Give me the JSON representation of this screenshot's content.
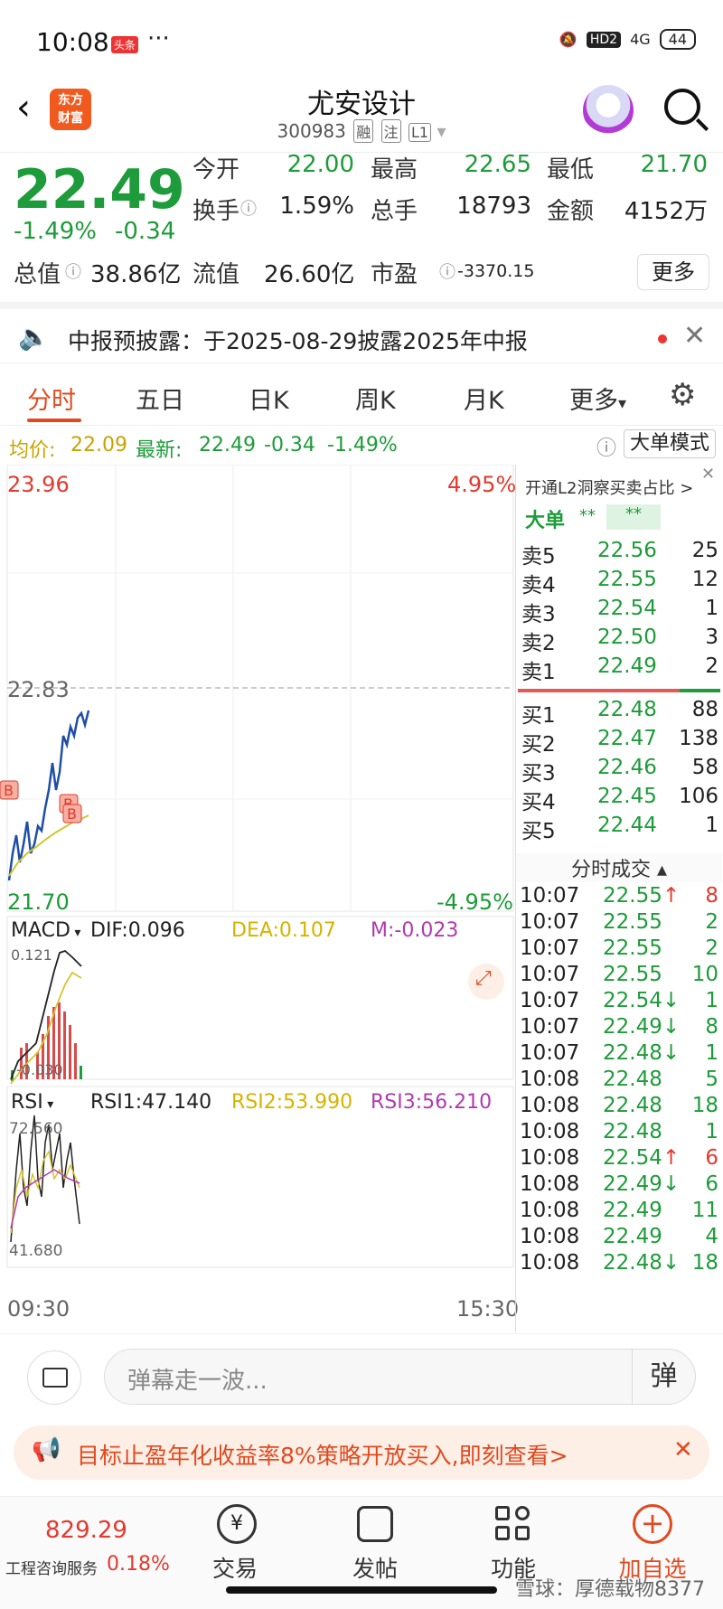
{
  "status": {
    "time": "10:08",
    "app": "头条",
    "dots": "···",
    "net": "HD2",
    "signal": "4G",
    "battery": "44"
  },
  "header": {
    "name": "尤安设计",
    "code": "300983",
    "tags": [
      "融",
      "注",
      "L1"
    ],
    "logo_line1": "东方",
    "logo_line2": "财富"
  },
  "quote": {
    "price": "22.49",
    "change_pct": "-1.49%",
    "change": "-0.34",
    "row1": [
      {
        "label": "今开",
        "value": "22.00"
      },
      {
        "label": "最高",
        "value": "22.65"
      },
      {
        "label": "最低",
        "value": "21.70"
      }
    ],
    "row2": [
      {
        "label": "换手",
        "value": "1.59%"
      },
      {
        "label": "总手",
        "value": "18793"
      },
      {
        "label": "金额",
        "value": "4152万"
      }
    ],
    "row3": [
      {
        "label": "总值",
        "value": "38.86亿"
      },
      {
        "label": "流值",
        "value": "26.60亿"
      },
      {
        "label": "市盈",
        "value": "-3370.15"
      }
    ],
    "more": "更多"
  },
  "notice": {
    "text": "中报预披露：于2025-08-29披露2025年中报"
  },
  "tabs": [
    "分时",
    "五日",
    "日K",
    "周K",
    "月K",
    "更多"
  ],
  "avg": {
    "avg_label": "均价:",
    "avg_value": "22.09",
    "last_label": "最新:",
    "last_value": "22.49",
    "chg": "-0.34",
    "pct": "-1.49%",
    "mode": "大单模式"
  },
  "chart": {
    "top": "23.96",
    "top_pct": "4.95%",
    "mid": "22.83",
    "bottom": "21.70",
    "bottom_pct": "-4.95%",
    "start": "09:30",
    "end": "15:30"
  },
  "macd": {
    "label": "MACD",
    "dif": "DIF:0.096",
    "dea": "DEA:0.107",
    "m": "M:-0.023",
    "max": "0.121",
    "min": "-0.030"
  },
  "rsi": {
    "label": "RSI",
    "rsi1": "RSI1:47.140",
    "rsi2": "RSI2:53.990",
    "rsi3": "RSI3:56.210",
    "max": "72.560",
    "min": "41.680"
  },
  "orderbook": {
    "l2": "开通L2洞察买卖占比 >",
    "bigorder": "大单",
    "stars": "**",
    "sells": [
      {
        "label": "卖5",
        "price": "22.56",
        "vol": "25"
      },
      {
        "label": "卖4",
        "price": "22.55",
        "vol": "12"
      },
      {
        "label": "卖3",
        "price": "22.54",
        "vol": "1"
      },
      {
        "label": "卖2",
        "price": "22.50",
        "vol": "3"
      },
      {
        "label": "卖1",
        "price": "22.49",
        "vol": "2"
      }
    ],
    "buys": [
      {
        "label": "买1",
        "price": "22.48",
        "vol": "88"
      },
      {
        "label": "买2",
        "price": "22.47",
        "vol": "138"
      },
      {
        "label": "买3",
        "price": "22.46",
        "vol": "58"
      },
      {
        "label": "买4",
        "price": "22.45",
        "vol": "106"
      },
      {
        "label": "买5",
        "price": "22.44",
        "vol": "1"
      }
    ],
    "trades_title": "分时成交",
    "trades": [
      {
        "time": "10:07",
        "price": "22.55",
        "arrow": "↑",
        "vol": "8"
      },
      {
        "time": "10:07",
        "price": "22.55",
        "arrow": "",
        "vol": "2"
      },
      {
        "time": "10:07",
        "price": "22.55",
        "arrow": "",
        "vol": "2"
      },
      {
        "time": "10:07",
        "price": "22.55",
        "arrow": "",
        "vol": "10"
      },
      {
        "time": "10:07",
        "price": "22.54",
        "arrow": "↓",
        "vol": "1"
      },
      {
        "time": "10:07",
        "price": "22.49",
        "arrow": "↓",
        "vol": "8"
      },
      {
        "time": "10:07",
        "price": "22.48",
        "arrow": "↓",
        "vol": "1"
      },
      {
        "time": "10:08",
        "price": "22.48",
        "arrow": "",
        "vol": "5"
      },
      {
        "time": "10:08",
        "price": "22.48",
        "arrow": "",
        "vol": "18"
      },
      {
        "time": "10:08",
        "price": "22.48",
        "arrow": "",
        "vol": "1"
      },
      {
        "time": "10:08",
        "price": "22.54",
        "arrow": "↑",
        "vol": "6"
      },
      {
        "time": "10:08",
        "price": "22.49",
        "arrow": "↓",
        "vol": "6"
      },
      {
        "time": "10:08",
        "price": "22.49",
        "arrow": "",
        "vol": "11"
      },
      {
        "time": "10:08",
        "price": "22.49",
        "arrow": "",
        "vol": "4"
      },
      {
        "time": "10:08",
        "price": "22.48",
        "arrow": "↓",
        "vol": "18"
      }
    ]
  },
  "comment": {
    "placeholder": "弹幕走一波...",
    "danmu": "弹"
  },
  "promo": {
    "text": "目标止盈年化收益率8%策略开放买入,即刻查看>"
  },
  "nav": {
    "index_value": "829.29",
    "index_name": "工程咨询服务",
    "index_pct": "0.18%",
    "items": [
      "交易",
      "发帖",
      "功能",
      "加自选"
    ]
  },
  "watermark": "雪球：厚德载物8377"
}
